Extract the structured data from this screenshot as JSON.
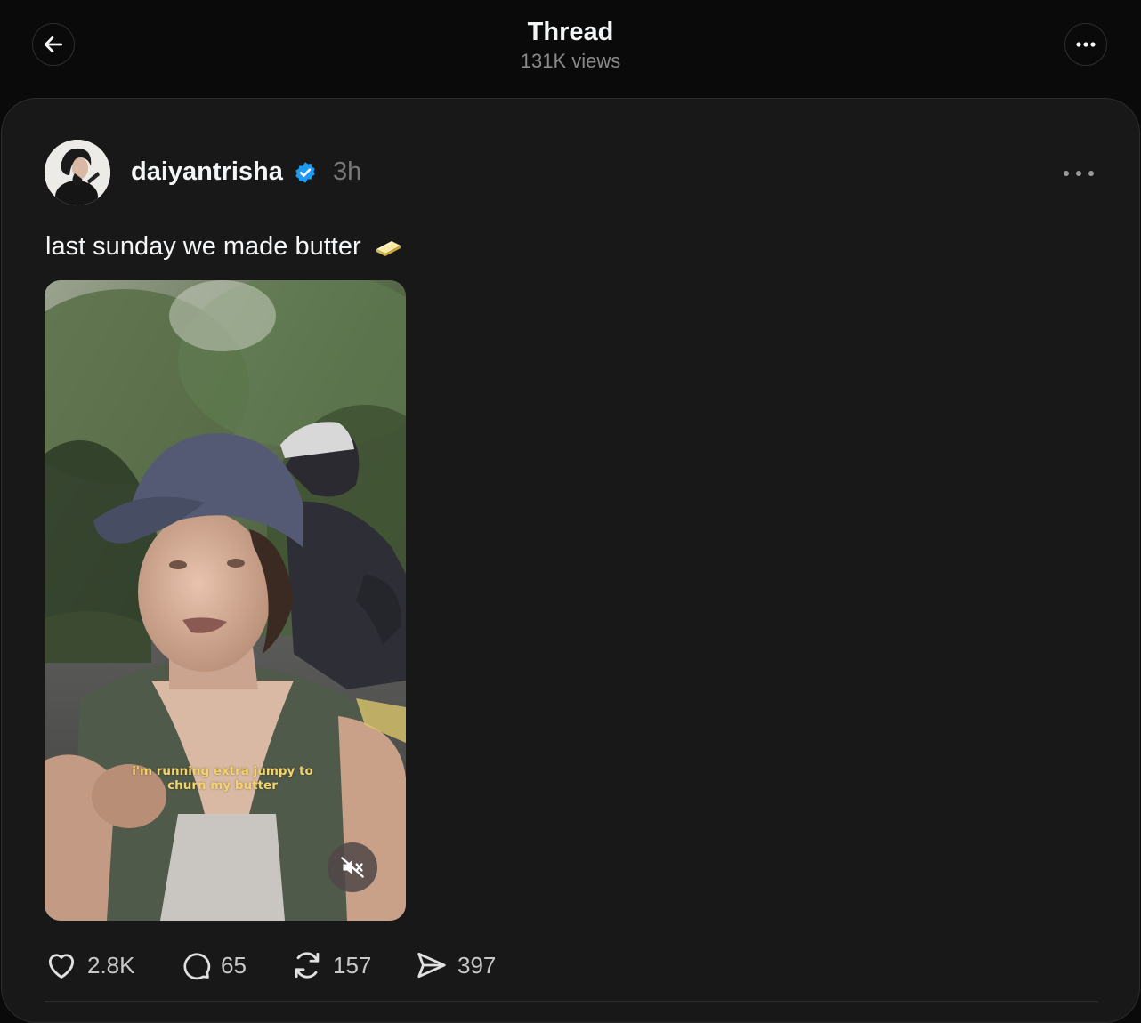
{
  "header": {
    "title": "Thread",
    "views": "131K views",
    "back_icon": "arrow-left-icon",
    "menu_icon": "more-horizontal-icon"
  },
  "post": {
    "username": "daiyantrisha",
    "verified": true,
    "time": "3h",
    "text": "last sunday we made butter",
    "emoji": "butter-icon",
    "media": {
      "caption_line1": "i'm running extra jumpy to",
      "caption_line2": "churn my butter",
      "muted": true
    },
    "actions": {
      "likes": "2.8K",
      "replies": "65",
      "reposts": "157",
      "shares": "397"
    }
  },
  "colors": {
    "background": "#0a0a0a",
    "card": "#181818",
    "verified_badge": "#1d9bf0",
    "muted_text": "#777777"
  }
}
